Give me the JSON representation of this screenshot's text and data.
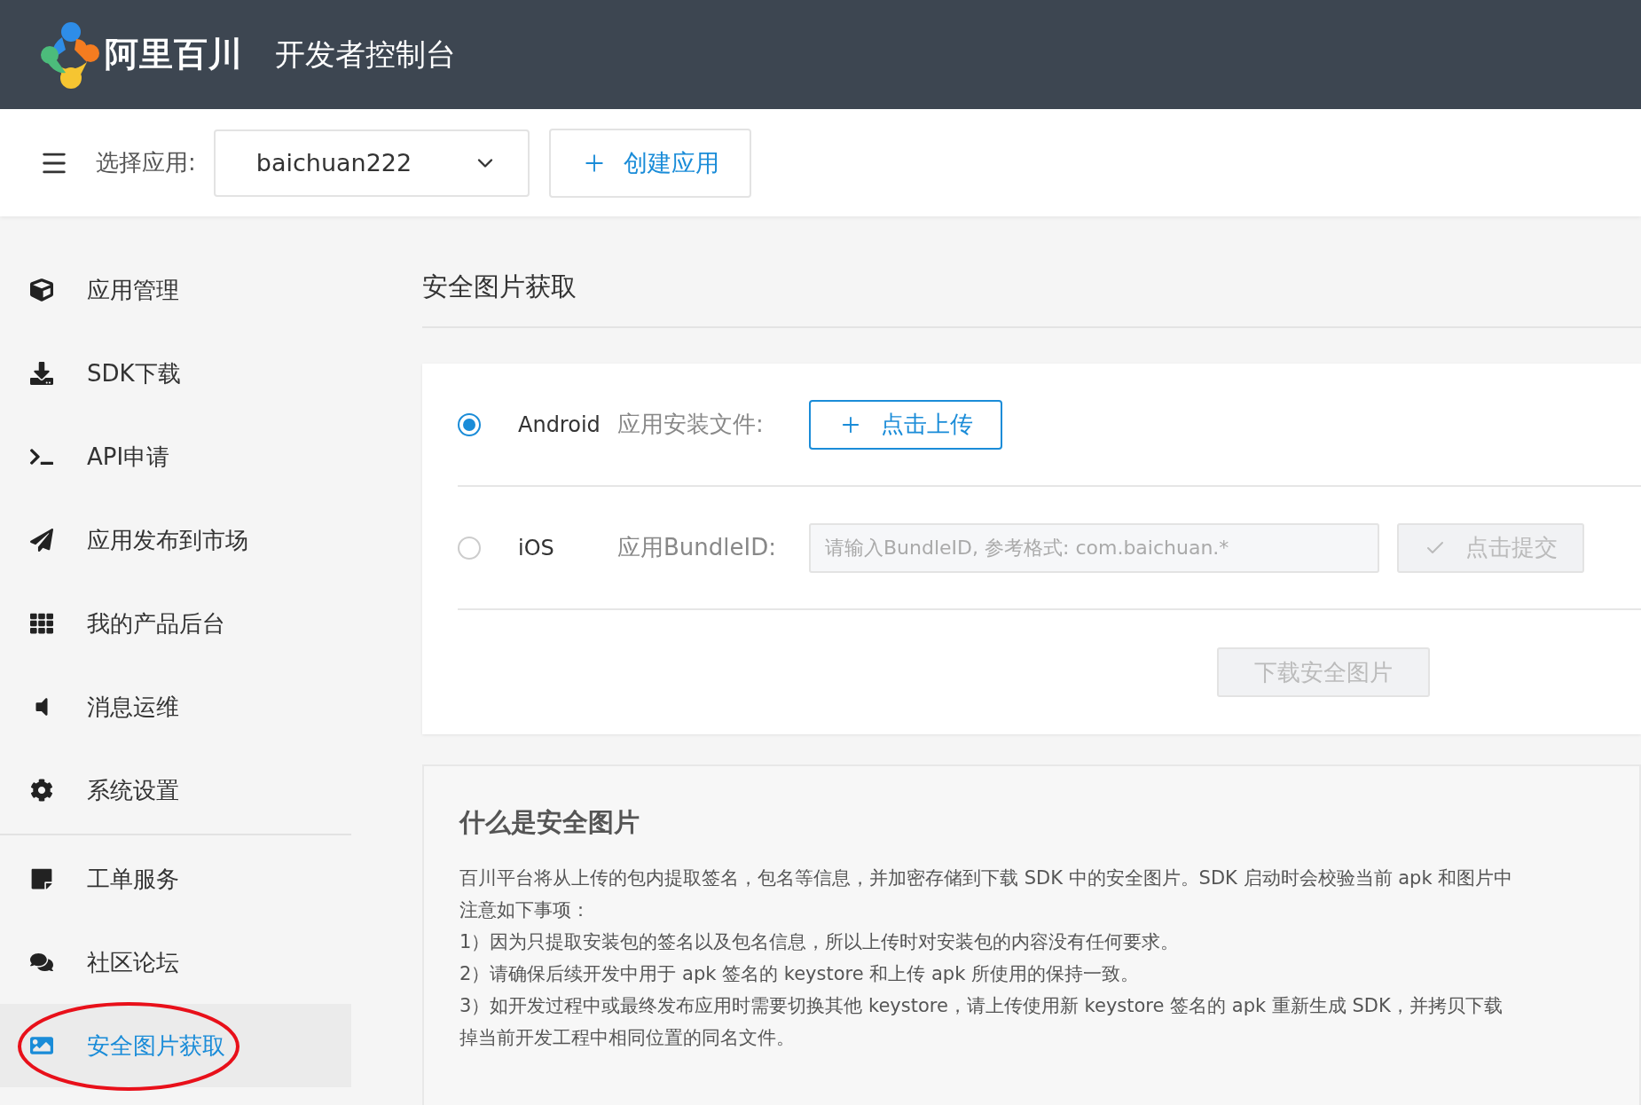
{
  "header": {
    "brand": "阿里百川",
    "title": "开发者控制台"
  },
  "toolbar": {
    "select_label": "选择应用:",
    "app_select": {
      "value": "baichuan222"
    },
    "create_button": "创建应用"
  },
  "sidebar": {
    "groups": [
      {
        "items": [
          {
            "label": "应用管理",
            "selected": false
          },
          {
            "label": "SDK下载",
            "selected": false
          },
          {
            "label": "API申请",
            "selected": false
          },
          {
            "label": "应用发布到市场",
            "selected": false
          },
          {
            "label": "我的产品后台",
            "selected": false
          },
          {
            "label": "消息运维",
            "selected": false
          },
          {
            "label": "系统设置",
            "selected": false
          }
        ]
      },
      {
        "items": [
          {
            "label": "工单服务",
            "selected": false
          },
          {
            "label": "社区论坛",
            "selected": false
          },
          {
            "label": "安全图片获取",
            "selected": true
          }
        ]
      }
    ]
  },
  "page_title": "安全图片获取",
  "form": {
    "platforms": [
      {
        "label": "Android",
        "selected": true,
        "field_label": "应用安装文件:",
        "kind": "upload",
        "button": {
          "label": "点击上传"
        }
      },
      {
        "label": "iOS",
        "selected": false,
        "field_label": "应用BundleID:",
        "kind": "input",
        "placeholder": "请输入BundleID, 参考格式: com.baichuan.*",
        "button": {
          "label": "点击提交",
          "disabled": true
        }
      }
    ],
    "download_button": {
      "label": "下载安全图片",
      "disabled": true
    }
  },
  "info": {
    "title": "什么是安全图片",
    "lines": [
      "百川平台将从上传的包内提取签名，包名等信息，并加密存储到下载 SDK 中的安全图片。SDK 启动时会校验当前 apk 和图片中",
      "注意如下事项：",
      "1）因为只提取安装包的签名以及包名信息，所以上传时对安装包的内容没有任何要求。",
      "2）请确保后续开发中用于 apk 签名的 keystore 和上传 apk 所使用的保持一致。",
      "3）如开发过程中或最终发布应用时需要切换其他 keystore，请上传使用新 keystore 签名的 apk 重新生成 SDK，并拷贝下载",
      "掉当前开发工程中相同位置的同名文件。"
    ]
  }
}
